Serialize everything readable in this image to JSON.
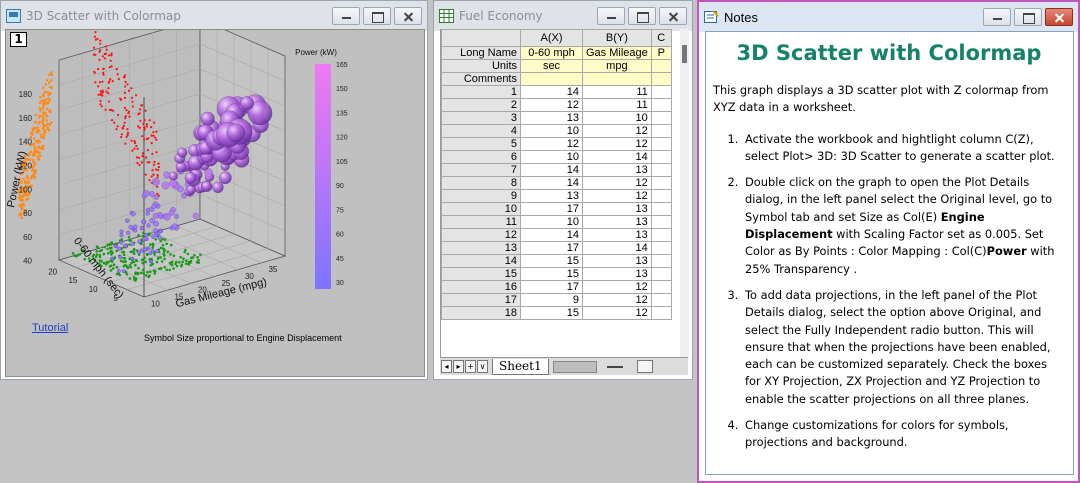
{
  "graph_window": {
    "title": "3D Scatter with Colormap",
    "layer_number": "1",
    "tutorial_link": "Tutorial",
    "footnote": "Symbol Size proportional to Engine Displacement"
  },
  "workbook_window": {
    "title": "Fuel Economy",
    "columns": [
      "A(X)",
      "B(Y)",
      "C"
    ],
    "row_headers": [
      "Long Name",
      "Units",
      "Comments"
    ],
    "long_names": [
      "0-60 mph",
      "Gas Mileage",
      "P"
    ],
    "units": [
      "sec",
      "mpg",
      ""
    ],
    "rows": [
      [
        "1",
        "14",
        "11"
      ],
      [
        "2",
        "12",
        "11"
      ],
      [
        "3",
        "13",
        "10"
      ],
      [
        "4",
        "10",
        "12"
      ],
      [
        "5",
        "12",
        "12"
      ],
      [
        "6",
        "10",
        "14"
      ],
      [
        "7",
        "14",
        "13"
      ],
      [
        "8",
        "14",
        "12"
      ],
      [
        "9",
        "13",
        "12"
      ],
      [
        "10",
        "17",
        "13"
      ],
      [
        "11",
        "10",
        "13"
      ],
      [
        "12",
        "14",
        "13"
      ],
      [
        "13",
        "17",
        "14"
      ],
      [
        "14",
        "15",
        "13"
      ],
      [
        "15",
        "15",
        "13"
      ],
      [
        "16",
        "17",
        "12"
      ],
      [
        "17",
        "9",
        "12"
      ],
      [
        "18",
        "15",
        "12"
      ]
    ],
    "sheet_tab": "Sheet1",
    "nav_glyphs": [
      "◂",
      "▸",
      "+",
      "∨"
    ]
  },
  "notes_window": {
    "title": "Notes",
    "heading": "3D Scatter with Colormap",
    "intro": "This graph displays a 3D scatter plot with Z colormap from XYZ data in a worksheet.",
    "steps": [
      {
        "parts": [
          "Activate the workbook and hightlight column C(Z), select Plot> 3D: 3D Scatter to generate a scatter plot."
        ]
      },
      {
        "parts": [
          "Double click on the graph to open the Plot Details dialog, in the left panel select the Original level, go to Symbol tab and set Size as Col(E) ",
          "Engine Displacement",
          " with Scaling Factor set as 0.005. Set Color as By Points : Color Mapping : Col(C)",
          "Power",
          " with 25% Transparency ."
        ]
      },
      {
        "parts": [
          "To add data projections, in the left panel of the Plot Details dialog, select the option above Original, and select the Fully Independent radio button. This will ensure that when the projections have been enabled, each can be customized separately. Check the boxes for XY Projection, ZX Projection and YZ Projection to enable the scatter projections on all three planes."
        ]
      },
      {
        "parts": [
          "Change customizations for colors for symbols, projections and background."
        ]
      }
    ]
  },
  "chart_data": {
    "type": "scatter",
    "title": "",
    "xlabel": "0-60 mph (sec)",
    "ylabel": "Gas Mileage (mpg)",
    "zlabel": "Power (kW)",
    "x_ticks": [
      "20",
      "15",
      "10",
      "5"
    ],
    "y_ticks": [
      "10",
      "15",
      "20",
      "25",
      "30",
      "35"
    ],
    "z_ticks": [
      "40",
      "60",
      "80",
      "100",
      "120",
      "140",
      "160",
      "180"
    ],
    "colorbar": {
      "title": "Power (kW)",
      "ticks": [
        "165",
        "150",
        "135",
        "120",
        "105",
        "90",
        "75",
        "60",
        "45",
        "30"
      ],
      "range": [
        30,
        165
      ],
      "colors": [
        "#7d74ff",
        "#f07af0"
      ]
    },
    "projection_colors": {
      "xz_plane": "#ff8a1a",
      "yz_plane": "#ff1010",
      "xy_plane": "#1a9a1a"
    },
    "grid": true,
    "background": "#c0c0c0"
  }
}
